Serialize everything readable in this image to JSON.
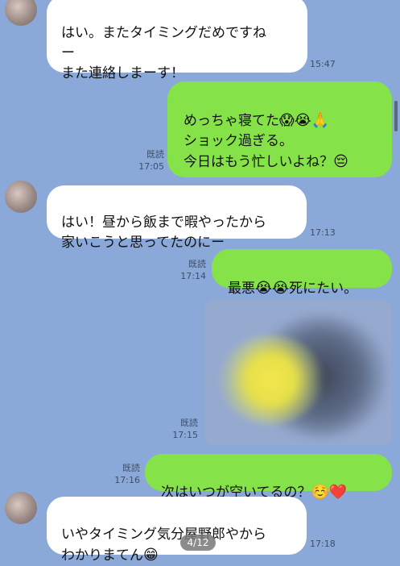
{
  "messages": [
    {
      "text": "はい。またタイミングだめですね\nー\nまた連絡しまーす！",
      "time": "15:47"
    },
    {
      "text": "めっちゃ寝てた",
      "emojis": "😱😭🙏",
      "text2": "\nショック過ぎる。\n今日はもう忙しいよね？",
      "emoji2": "😔",
      "read": "既読",
      "time": "17:05"
    },
    {
      "text": "はい！昼から飯まで暇やったから\n家いこうと思ってたのにー",
      "time": "17:13"
    },
    {
      "text_a": "最悪",
      "emoji_a": "😭😭",
      "text_b": "死にたい。",
      "read": "既読",
      "time": "17:14"
    },
    {
      "read": "既読",
      "time": "17:15"
    },
    {
      "text": "次はいつが空いてるの？",
      "emojis": "☺️❤️",
      "read": "既読",
      "time": "17:16"
    },
    {
      "text": "いやタイミング気分屋野郎やから\nわかりまてん",
      "emoji": "😁",
      "time": "17:18"
    }
  ],
  "page_indicator": "4/12",
  "colors": {
    "background": "#8ba9d8",
    "incoming": "#ffffff",
    "outgoing": "#85e249"
  }
}
